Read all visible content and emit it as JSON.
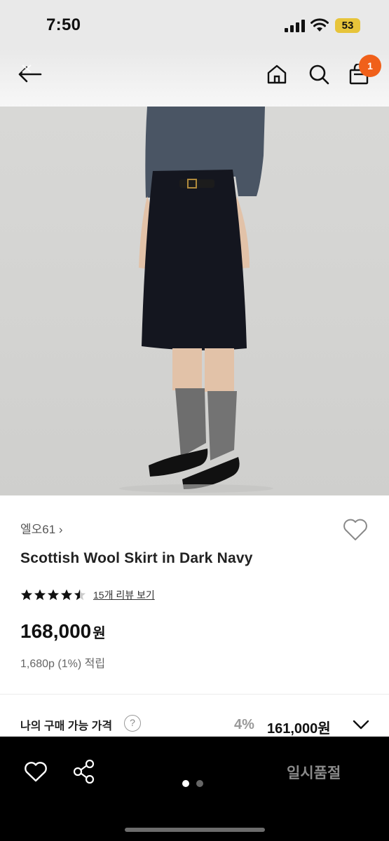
{
  "status_bar": {
    "time": "7:50",
    "battery": "53"
  },
  "top_nav": {
    "back_icon": "back-arrow-icon",
    "home_icon": "home-icon",
    "search_icon": "search-icon",
    "cart_icon": "shopping-bag-icon",
    "cart_count": "1"
  },
  "product": {
    "brand": "엘오61 ›",
    "title": "Scottish Wool Skirt in Dark Navy",
    "rating": 4.5,
    "review_link": "15개 리뷰 보기",
    "price": "168,000",
    "price_unit": "원",
    "points": "1,680p (1%) 적립",
    "my_price_label": "나의 구매 가능 가격",
    "help_icon": "?",
    "discount": "4%",
    "my_price": "161,000원"
  },
  "bottom_bar": {
    "sold_out": "일시품절",
    "carousel_total": 2,
    "carousel_active": 1
  },
  "colors": {
    "accent_badge": "#f0601a",
    "battery": "#e7c43a",
    "bottom_bar": "#000000",
    "sold_out_text": "#8a8a8a"
  }
}
